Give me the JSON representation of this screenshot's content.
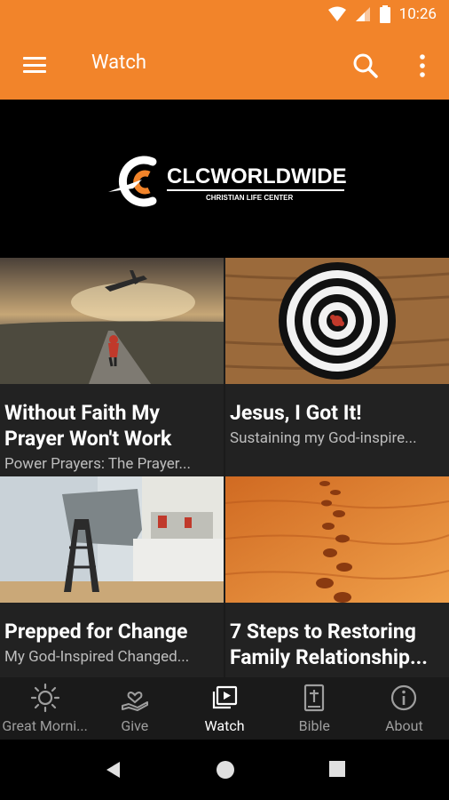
{
  "status_bar": {
    "time": "10:26"
  },
  "app_bar": {
    "title": "Watch"
  },
  "banner": {
    "logo_text": "CLCWORLDWIDE",
    "logo_subtext": "CHRISTIAN LIFE CENTER"
  },
  "cards": [
    {
      "title": "Without Faith My Prayer Won't Work",
      "subtitle": "Power Prayers: The Prayer..."
    },
    {
      "title": "Jesus, I Got It!",
      "subtitle": "Sustaining my God-inspire..."
    },
    {
      "title": "Prepped for Change",
      "subtitle": "My God-Inspired Changed..."
    },
    {
      "title": "7 Steps to Restoring Family Relationship...",
      "subtitle": ""
    }
  ],
  "bottom_nav": {
    "active": "Watch",
    "items": [
      {
        "label": "Great Morni...",
        "icon": "sun-icon"
      },
      {
        "label": "Give",
        "icon": "give-hand-icon"
      },
      {
        "label": "Watch",
        "icon": "video-library-icon"
      },
      {
        "label": "Bible",
        "icon": "bible-icon"
      },
      {
        "label": "About",
        "icon": "info-icon"
      }
    ]
  },
  "colors": {
    "accent": "#f2842a",
    "background": "#000000",
    "card_bg": "#222222",
    "nav_bg": "#1a1a1a"
  }
}
